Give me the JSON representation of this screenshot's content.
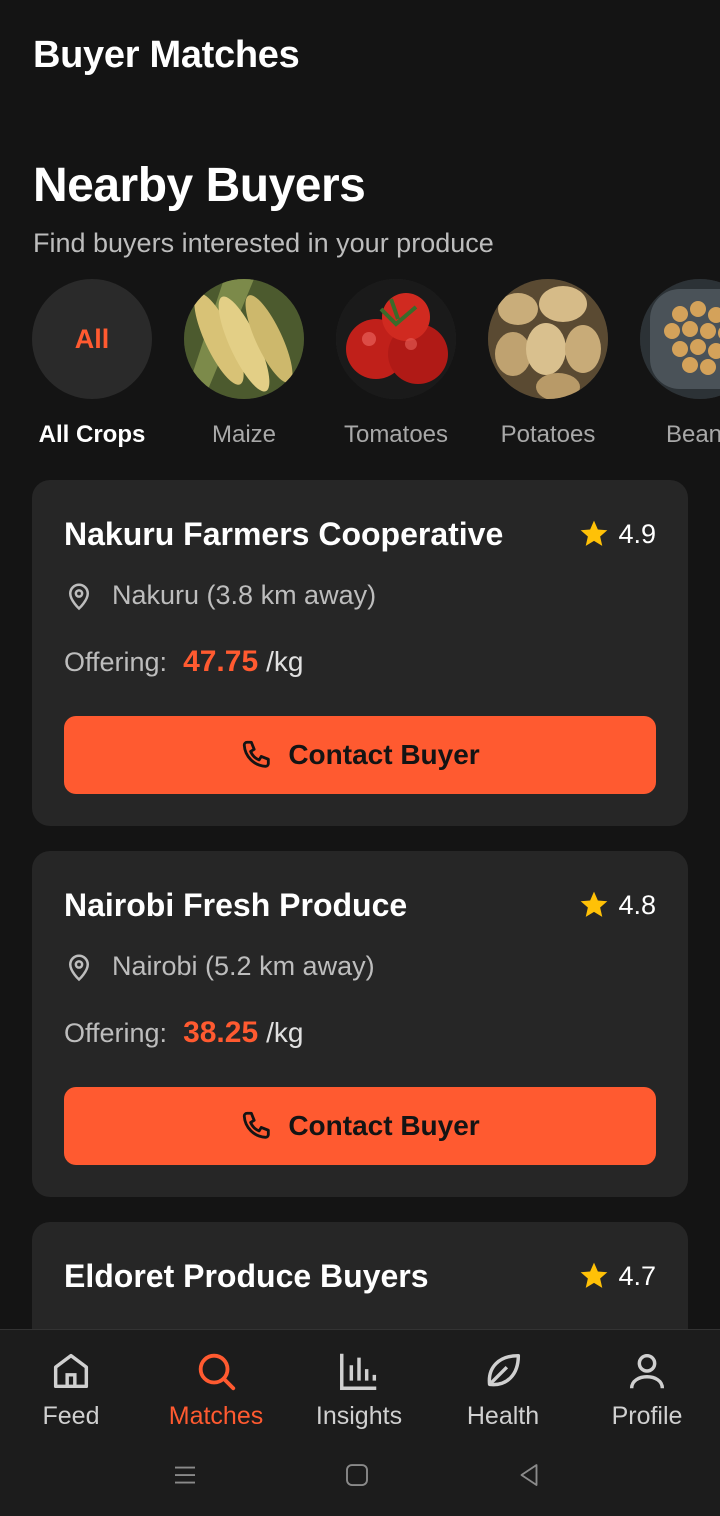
{
  "header": {
    "title": "Buyer Matches"
  },
  "section": {
    "title": "Nearby Buyers",
    "subtitle": "Find buyers interested in your produce"
  },
  "crops": [
    {
      "label": "All Crops",
      "badge": "All",
      "icon": "all-badge"
    },
    {
      "label": "Maize",
      "icon": "maize-image"
    },
    {
      "label": "Tomatoes",
      "icon": "tomatoes-image"
    },
    {
      "label": "Potatoes",
      "icon": "potatoes-image"
    },
    {
      "label": "Beans",
      "icon": "beans-image"
    }
  ],
  "buyers": [
    {
      "name": "Nakuru Farmers Cooperative",
      "rating": "4.9",
      "location": "Nakuru (3.8 km away)",
      "offering_label": "Offering:",
      "price": "47.75",
      "unit": "/kg",
      "button": "Contact Buyer"
    },
    {
      "name": "Nairobi Fresh Produce",
      "rating": "4.8",
      "location": "Nairobi (5.2 km away)",
      "offering_label": "Offering:",
      "price": "38.25",
      "unit": "/kg",
      "button": "Contact Buyer"
    },
    {
      "name": "Eldoret Produce Buyers",
      "rating": "4.7"
    }
  ],
  "nav": [
    {
      "label": "Feed",
      "icon": "home-icon"
    },
    {
      "label": "Matches",
      "icon": "search-icon",
      "active": true
    },
    {
      "label": "Insights",
      "icon": "bar-chart-icon"
    },
    {
      "label": "Health",
      "icon": "leaf-icon"
    },
    {
      "label": "Profile",
      "icon": "user-icon"
    }
  ],
  "colors": {
    "accent": "#ff5a30",
    "background": "#141414",
    "card": "#262626",
    "star": "#ffc107"
  }
}
